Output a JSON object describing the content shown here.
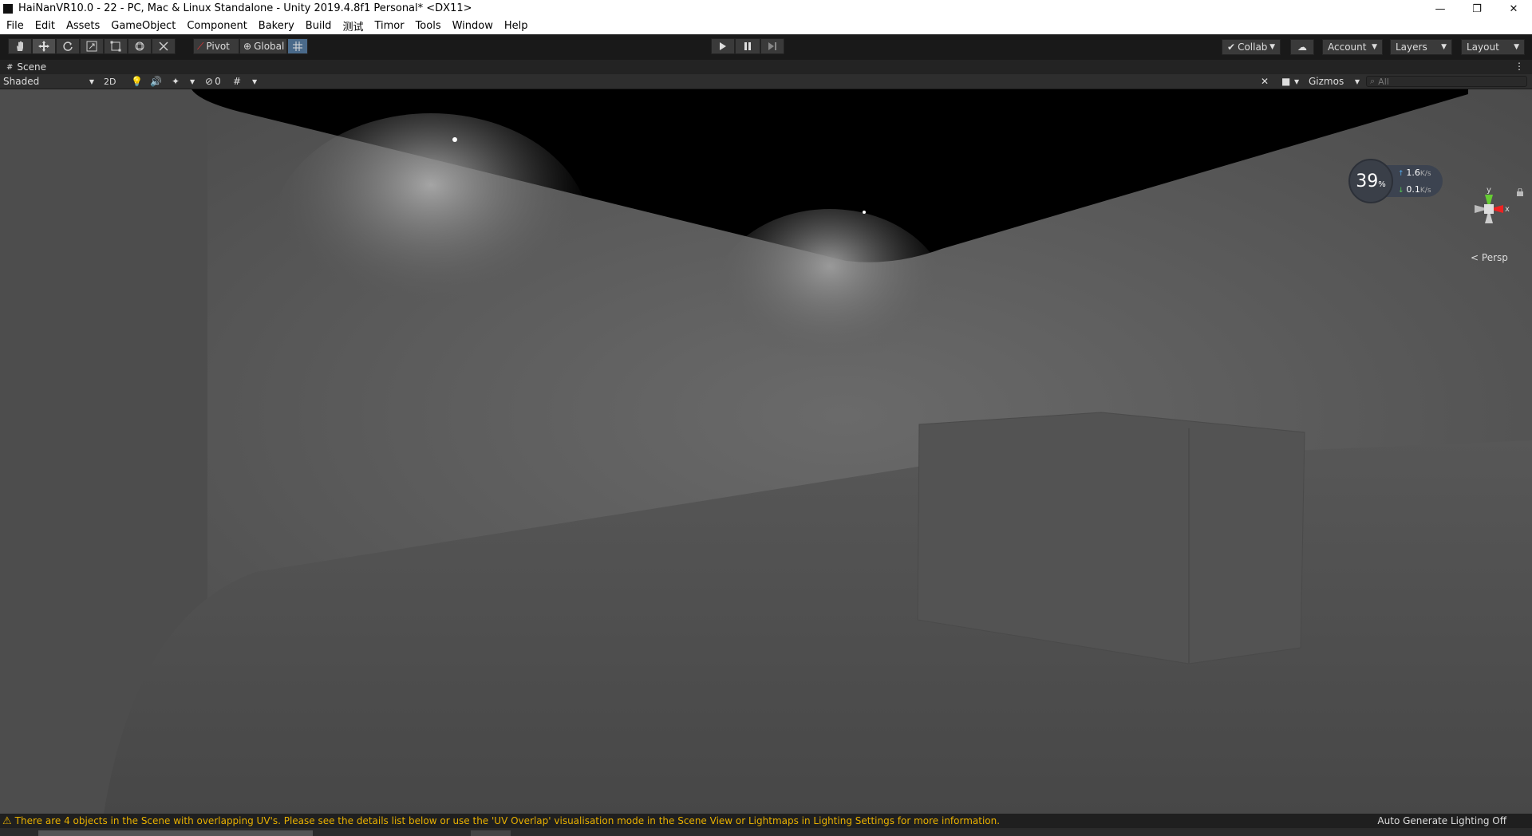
{
  "window": {
    "title": "HaiNanVR10.0 - 22 - PC, Mac & Linux Standalone - Unity 2019.4.8f1 Personal* <DX11>",
    "minimize": "—",
    "maximize": "❐",
    "close": "✕"
  },
  "menu": [
    "File",
    "Edit",
    "Assets",
    "GameObject",
    "Component",
    "Bakery",
    "Build",
    "测试",
    "Timor",
    "Tools",
    "Window",
    "Help"
  ],
  "toolbar": {
    "tools": [
      "hand-tool-icon",
      "move-tool-icon",
      "rotate-tool-icon",
      "scale-tool-icon",
      "rect-tool-icon",
      "transform-tool-icon",
      "custom-tool-icon"
    ],
    "pivot_label": "Pivot",
    "global_label": "Global",
    "collab_label": "Collab",
    "account_label": "Account",
    "layers_label": "Layers",
    "layout_label": "Layout"
  },
  "scene": {
    "tab_label": "Scene",
    "shading_mode": "Shaded",
    "mode_2d": "2D",
    "hidden_count": "0",
    "gizmos_label": "Gizmos",
    "search_placeholder": "All",
    "persp_label": "Persp",
    "gizmo_y": "y",
    "gizmo_x": "x"
  },
  "perf_overlay": {
    "percent": "39",
    "percent_unit": "%",
    "upload": "1.6",
    "download": "0.1",
    "unit": "K/s"
  },
  "status": {
    "warning": "There are 4 objects in the Scene with overlapping UV's. Please see the details list below or use the 'UV Overlap' visualisation mode in the Scene View or Lightmaps in Lighting Settings for more information.",
    "lighting": "Auto Generate Lighting Off"
  }
}
